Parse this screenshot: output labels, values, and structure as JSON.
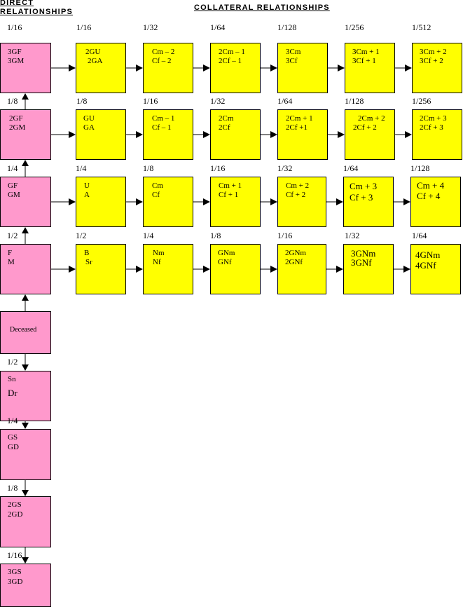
{
  "headers": {
    "direct_line1": "DIRECT",
    "direct_line2": "RELATIONSHIPS",
    "collateral": "COLLATERAL RELATIONSHIPS"
  },
  "colors": {
    "direct": "#ff99cc",
    "collateral": "#ffff00",
    "line": "#000000"
  },
  "direct": [
    {
      "frac": "1/16",
      "l1": "3GF",
      "l2": "3GM"
    },
    {
      "frac": "1/8",
      "l1": "2GF",
      "l2": "2GM"
    },
    {
      "frac": "1/4",
      "l1": "GF",
      "l2": "GM"
    },
    {
      "frac": "1/2",
      "l1": "F",
      "l2": "M"
    },
    {
      "frac": "",
      "l1": "Deceased",
      "l2": ""
    },
    {
      "frac": "1/2",
      "l1": "Sn",
      "l2": "Dr"
    },
    {
      "frac": "1/4",
      "l1": "GS",
      "l2": "GD"
    },
    {
      "frac": "1/8",
      "l1": "2GS",
      "l2": "2GD"
    },
    {
      "frac": "1/16",
      "l1": "3GS",
      "l2": "3GD"
    }
  ],
  "collateral": [
    [
      {
        "frac": "1/16",
        "l1": "2GU",
        "l2": "2GA"
      },
      {
        "frac": "1/32",
        "l1": "Cm – 2",
        "l2": "Cf – 2"
      },
      {
        "frac": "1/64",
        "l1": "2Cm – 1",
        "l2": "2Cf – 1"
      },
      {
        "frac": "1/128",
        "l1": "3Cm",
        "l2": "3Cf"
      },
      {
        "frac": "1/256",
        "l1": "3Cm + 1",
        "l2": "3Cf + 1"
      },
      {
        "frac": "1/512",
        "l1": "3Cm + 2",
        "l2": "3Cf + 2"
      }
    ],
    [
      {
        "frac": "1/8",
        "l1": "GU",
        "l2": "GA"
      },
      {
        "frac": "1/16",
        "l1": "Cm – 1",
        "l2": "Cf – 1"
      },
      {
        "frac": "1/32",
        "l1": "2Cm",
        "l2": "2Cf"
      },
      {
        "frac": "1/64",
        "l1": "2Cm + 1",
        "l2": "2Cf +1"
      },
      {
        "frac": "1/128",
        "l1": "2Cm + 2",
        "l2": "2Cf + 2"
      },
      {
        "frac": "1/256",
        "l1": "2Cm + 3",
        "l2": "2Cf + 3"
      }
    ],
    [
      {
        "frac": "1/4",
        "l1": "U",
        "l2": "A"
      },
      {
        "frac": "1/8",
        "l1": "Cm",
        "l2": "Cf"
      },
      {
        "frac": "1/16",
        "l1": "Cm + 1",
        "l2": "Cf + 1"
      },
      {
        "frac": "1/32",
        "l1": "Cm + 2",
        "l2": "Cf + 2"
      },
      {
        "frac": "1/64",
        "l1": "Cm + 3",
        "l2": "Cf + 3"
      },
      {
        "frac": "1/128",
        "l1": "Cm + 4",
        "l2": "Cf + 4"
      }
    ],
    [
      {
        "frac": "1/2",
        "l1": "B",
        "l2": "Sr"
      },
      {
        "frac": "1/4",
        "l1": "Nm",
        "l2": "Nf"
      },
      {
        "frac": "1/8",
        "l1": "GNm",
        "l2": "GNf"
      },
      {
        "frac": "1/16",
        "l1": "2GNm",
        "l2": "2GNf"
      },
      {
        "frac": "1/32",
        "l1": "3GNm",
        "l2": "3GNf"
      },
      {
        "frac": "1/64",
        "l1": "4GNm",
        "l2": "4GNf"
      }
    ]
  ]
}
